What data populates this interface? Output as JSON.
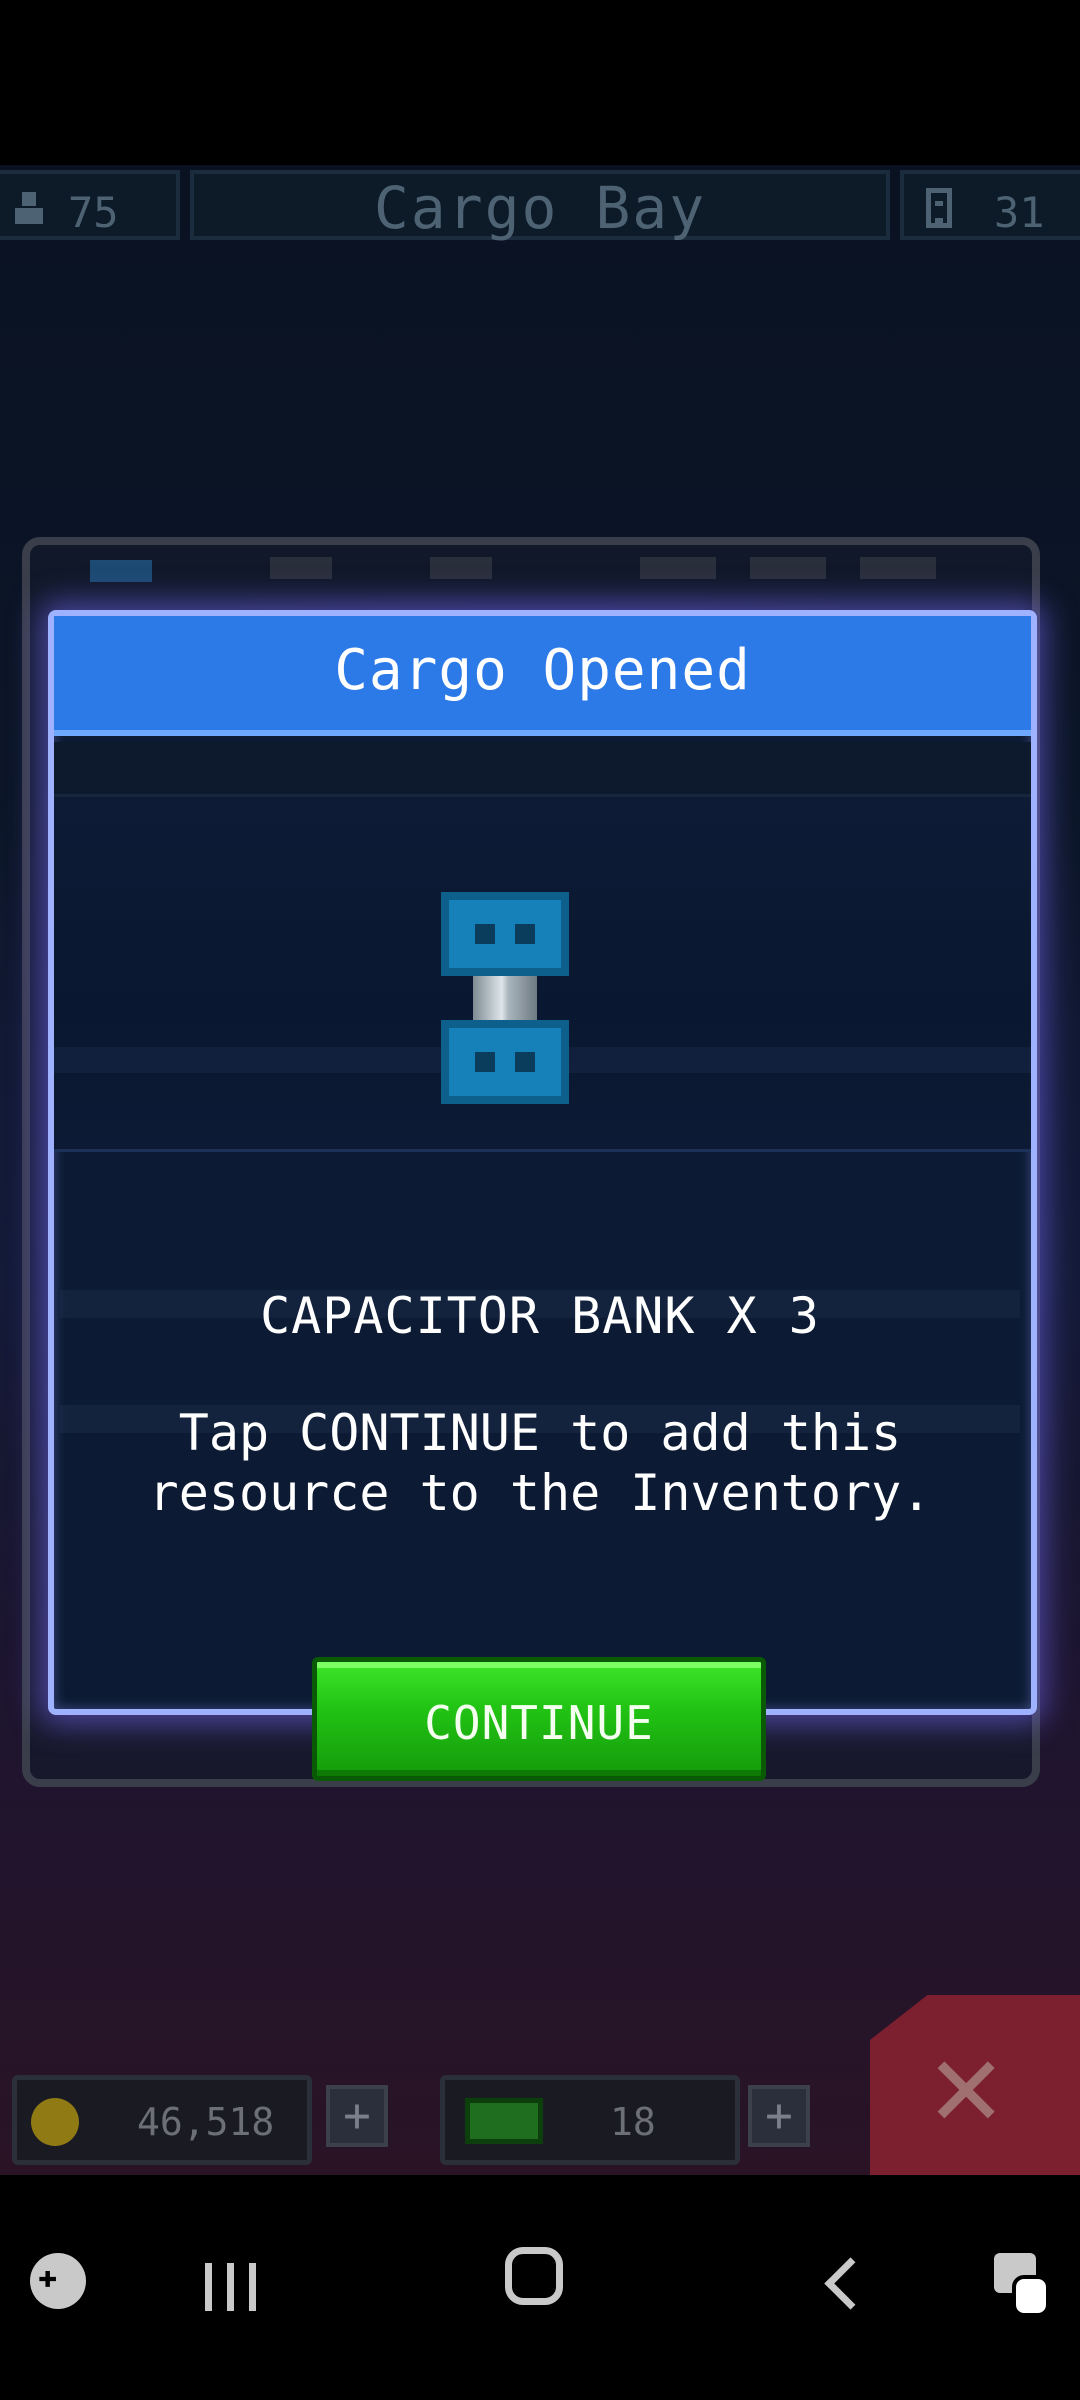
{
  "topbar": {
    "crew_count": "75",
    "title": "Cargo Bay",
    "rooms_count": "31"
  },
  "modal": {
    "title": "Cargo Opened",
    "item_name": "CAPACITOR BANK X 3",
    "description": "Tap CONTINUE to add this resource to the Inventory.",
    "continue_label": "CONTINUE"
  },
  "resources": {
    "coins": "46,518",
    "gems": "18",
    "plus": "+"
  },
  "icons": {
    "crew": "person-icon",
    "rooms": "room-icon",
    "item": "capacitor-icon",
    "coin": "coin-icon",
    "gem": "gem-icon",
    "close": "close-icon"
  },
  "colors": {
    "header": "#2b7ae8",
    "continue": "#22c414",
    "modal_border": "#9fb2ff"
  }
}
